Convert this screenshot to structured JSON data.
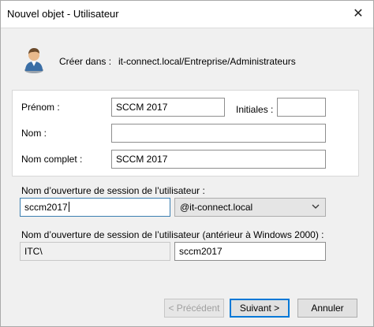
{
  "window": {
    "title": "Nouvel objet - Utilisateur",
    "close_glyph": "✕"
  },
  "header": {
    "create_label": "Créer dans :",
    "create_path": "it-connect.local/Entreprise/Administrateurs",
    "icon": "user-icon"
  },
  "form": {
    "first_name_label": "Prénom :",
    "first_name_value": "SCCM 2017",
    "initials_label": "Initiales :",
    "initials_value": "",
    "last_name_label": "Nom :",
    "last_name_value": "",
    "full_name_label": "Nom complet :",
    "full_name_value": "SCCM 2017",
    "logon_label": "Nom d’ouverture de session de l’utilisateur :",
    "logon_value": "sccm2017",
    "domain_selected": "@it-connect.local",
    "legacy_logon_label": "Nom d’ouverture de session de l’utilisateur (antérieur à Windows 2000) :",
    "legacy_domain_value": "ITC\\",
    "legacy_logon_value": "sccm2017"
  },
  "buttons": {
    "previous": "< Précédent",
    "next": "Suivant >",
    "cancel": "Annuler"
  },
  "colors": {
    "accent": "#0078d7",
    "dialog_background": "#f0f0f0"
  }
}
